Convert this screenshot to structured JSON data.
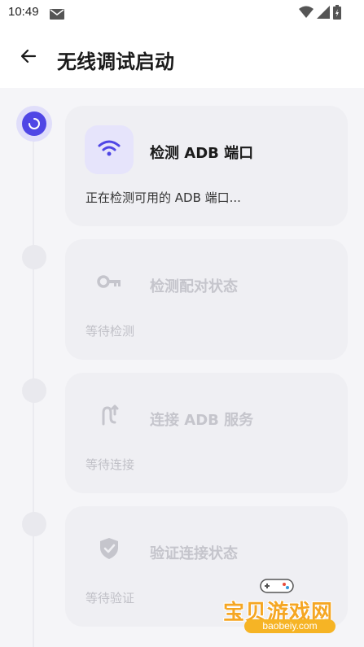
{
  "status_bar": {
    "time": "10:49",
    "icons": [
      "mail-icon",
      "wifi-icon",
      "signal-icon",
      "battery-icon"
    ]
  },
  "header": {
    "back_icon": "arrow-left-icon",
    "title": "无线调试启动"
  },
  "colors": {
    "accent": "#4f46e5",
    "accent_light": "#e0defa",
    "card_bg": "#efeff3",
    "pending_text": "#c5c5cc"
  },
  "steps": [
    {
      "title": "检测 ADB 端口",
      "status": "正在检测可用的 ADB 端口...",
      "icon": "wifi-icon",
      "state": "active"
    },
    {
      "title": "检测配对状态",
      "status": "等待检测",
      "icon": "key-icon",
      "state": "pending"
    },
    {
      "title": "连接 ADB 服务",
      "status": "等待连接",
      "icon": "route-icon",
      "state": "pending"
    },
    {
      "title": "验证连接状态",
      "status": "等待验证",
      "icon": "shield-check-icon",
      "state": "pending"
    }
  ],
  "watermark": {
    "text": "宝贝游戏网",
    "url": "baobeiy.com",
    "icon": "gamepad-icon"
  }
}
